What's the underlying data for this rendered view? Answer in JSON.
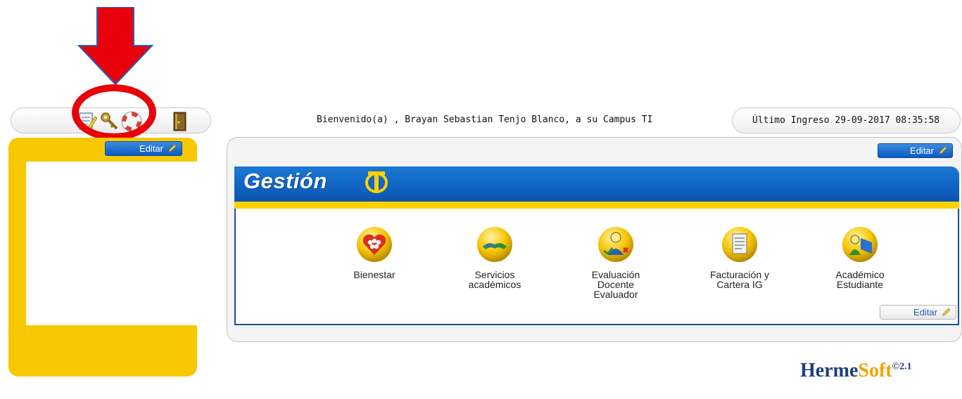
{
  "toolbar": {
    "icons": [
      "edit-notes-icon",
      "key-icon",
      "lifebuoy-icon",
      "exit-door-icon"
    ]
  },
  "sidebar": {
    "edit_label": "Editar"
  },
  "header": {
    "welcome": "Bienvenido(a) , Brayan Sebastian Tenjo Blanco, a su Campus TI",
    "last_login": "Último Ingreso 29-09-2017 08:35:58"
  },
  "main": {
    "edit_label_top": "Editar",
    "section_title": "Gestión",
    "edit_label_bottom": "Editar",
    "modules": [
      {
        "label": "Bienestar",
        "icon": "heart-faces-icon"
      },
      {
        "label": "Servicios\nacadémicos",
        "icon": "handshake-icon"
      },
      {
        "label": "Evaluación\nDocente\nEvaluador",
        "icon": "evaluator-icon"
      },
      {
        "label": "Facturación y\nCartera IG",
        "icon": "invoice-icon"
      },
      {
        "label": "Académico\nEstudiante",
        "icon": "student-book-icon"
      }
    ]
  },
  "branding": {
    "name_part1": "Herme",
    "name_part2": "Soft",
    "version": "©\n2.1"
  },
  "colors": {
    "accent_yellow": "#f7c800",
    "banner_blue": "#0f5fbf",
    "annotation_red": "#e8000b"
  }
}
